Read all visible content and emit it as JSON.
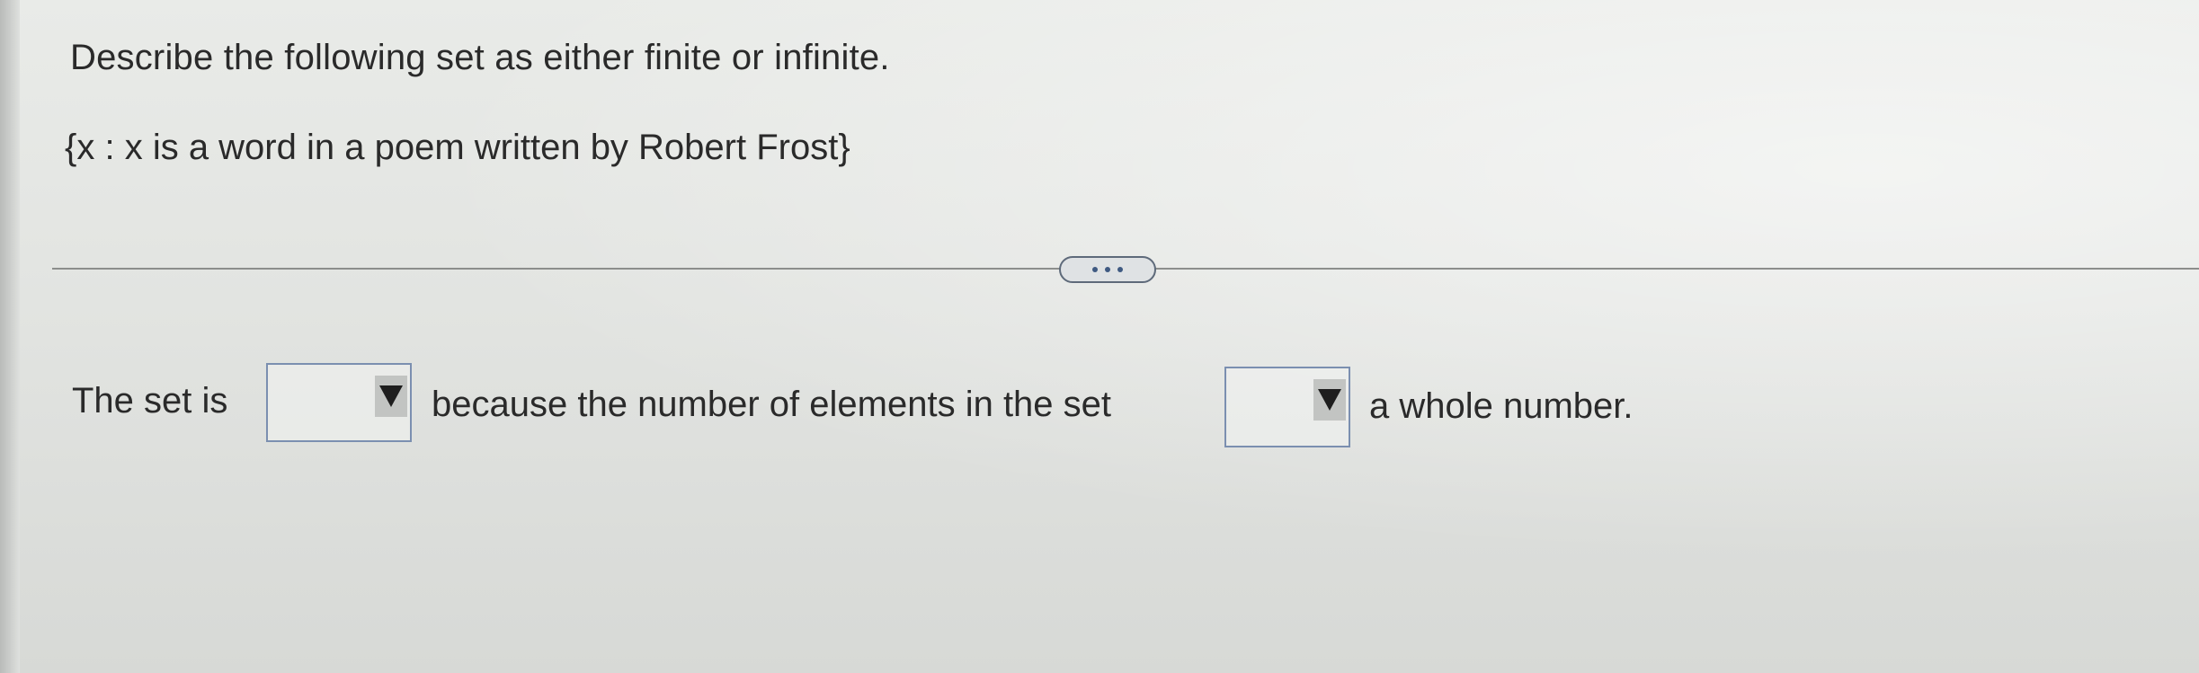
{
  "question": {
    "prompt": "Describe the following set as either finite or infinite.",
    "set_notation": "{x : x is a word in a poem written by Robert Frost}"
  },
  "divider": {
    "more_button_icon": "ellipsis-icon"
  },
  "answer": {
    "prefix": "The set is",
    "middle": "because the number of elements in the set",
    "suffix": "a whole number.",
    "dropdown1_value": "",
    "dropdown2_value": ""
  }
}
